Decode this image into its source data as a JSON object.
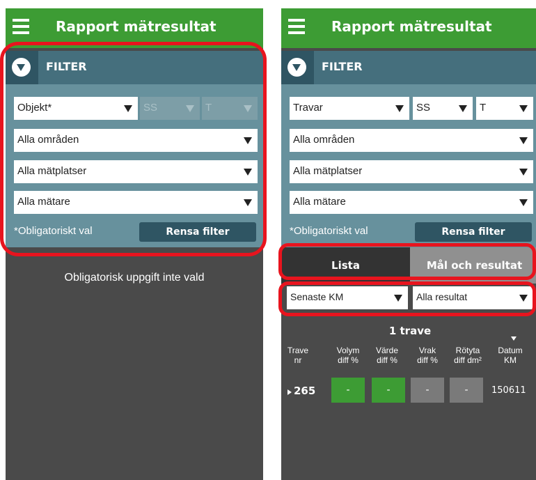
{
  "app": {
    "title": "Rapport mätresultat"
  },
  "filter": {
    "title": "FILTER",
    "obligatory_note": "*Obligatoriskt val",
    "clear_button": "Rensa filter"
  },
  "left": {
    "objekt": "Objekt*",
    "ss": "SS",
    "t": "T",
    "omraden": "Alla områden",
    "matplatser": "Alla mätplatser",
    "matare": "Alla mätare",
    "empty_message": "Obligatorisk uppgift inte vald"
  },
  "right": {
    "objekt": "Travar",
    "ss": "SS",
    "t": "T",
    "omraden": "Alla områden",
    "matplatser": "Alla mätplatser",
    "matare": "Alla mätare",
    "tabs": {
      "lista": "Lista",
      "mal": "Mål och resultat"
    },
    "sort_select": "Senaste KM",
    "result_select": "Alla resultat",
    "results_count": "1 trave",
    "columns": [
      {
        "line1": "Trave",
        "line2": "nr"
      },
      {
        "line1": "Volym",
        "line2": "diff %"
      },
      {
        "line1": "Värde",
        "line2": "diff %"
      },
      {
        "line1": "Vrak",
        "line2": "diff %"
      },
      {
        "line1": "Rötyta",
        "line2": "diff dm²"
      },
      {
        "line1": "Datum",
        "line2": "KM"
      }
    ],
    "row": {
      "trave_nr": "265",
      "volym": "-",
      "varde": "-",
      "vrak": "-",
      "rotyta": "-",
      "datum": "150611"
    }
  },
  "colors": {
    "appbar": "#3d9c34",
    "filter_panel": "#67919d",
    "filter_header": "#456f7d",
    "body_bg": "#4a4a4a",
    "highlight": "#e8141e"
  }
}
